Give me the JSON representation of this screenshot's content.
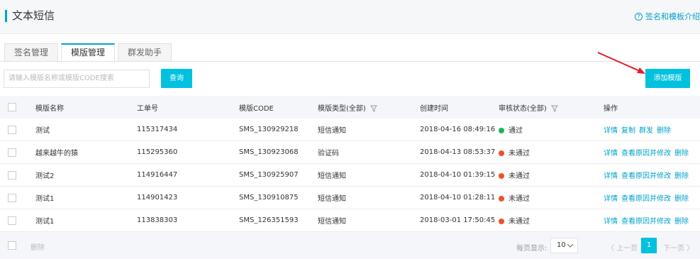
{
  "header": {
    "title": "文本短信",
    "help_link": "签名和模板介绍"
  },
  "tabs": [
    {
      "label": "签名管理",
      "active": false
    },
    {
      "label": "模版管理",
      "active": true
    },
    {
      "label": "群发助手",
      "active": false
    }
  ],
  "search": {
    "placeholder": "请输入模版名称或模版CODE搜索",
    "query_button": "查询"
  },
  "add_button": "添加模版",
  "table": {
    "columns": {
      "name": "模版名称",
      "order_no": "工单号",
      "code": "模版CODE",
      "type": "模版类型(全部)",
      "created": "创建时间",
      "status": "审核状态(全部)",
      "actions": "操作"
    },
    "rows": [
      {
        "name": "测试",
        "order_no": "115317434",
        "code": "SMS_130929218",
        "type": "短信通知",
        "created": "2018-04-16 08:49:16",
        "status": "通过",
        "status_color": "#1fb25a",
        "actions": [
          "详情",
          "复制",
          "群发",
          "删除"
        ]
      },
      {
        "name": "越来越牛的猿",
        "order_no": "115295360",
        "code": "SMS_130923068",
        "type": "验证码",
        "created": "2018-04-13 08:53:37",
        "status": "未通过",
        "status_color": "#f04f24",
        "actions": [
          "详情",
          "查看原因并修改",
          "删除"
        ]
      },
      {
        "name": "测试2",
        "order_no": "114916447",
        "code": "SMS_130925907",
        "type": "短信通知",
        "created": "2018-04-10 01:39:15",
        "status": "未通过",
        "status_color": "#f04f24",
        "actions": [
          "详情",
          "查看原因并修改",
          "删除"
        ]
      },
      {
        "name": "测试1",
        "order_no": "114901423",
        "code": "SMS_130910875",
        "type": "短信通知",
        "created": "2018-04-10 01:28:11",
        "status": "未通过",
        "status_color": "#f04f24",
        "actions": [
          "详情",
          "查看原因并修改",
          "删除"
        ]
      },
      {
        "name": "测试1",
        "order_no": "113838303",
        "code": "SMS_126351593",
        "type": "短信通知",
        "created": "2018-03-01 17:50:45",
        "status": "未通过",
        "status_color": "#f04f24",
        "actions": [
          "详情",
          "查看原因并修改",
          "删除"
        ]
      }
    ]
  },
  "footer": {
    "delete_label": "删除",
    "page_size_label": "每页显示:",
    "page_size": "10",
    "prev": "上一页",
    "current_page": "1",
    "next": "下一页"
  },
  "colors": {
    "accent": "#00c1de",
    "link": "#00a2ca",
    "annotation_arrow": "#e8192c"
  }
}
